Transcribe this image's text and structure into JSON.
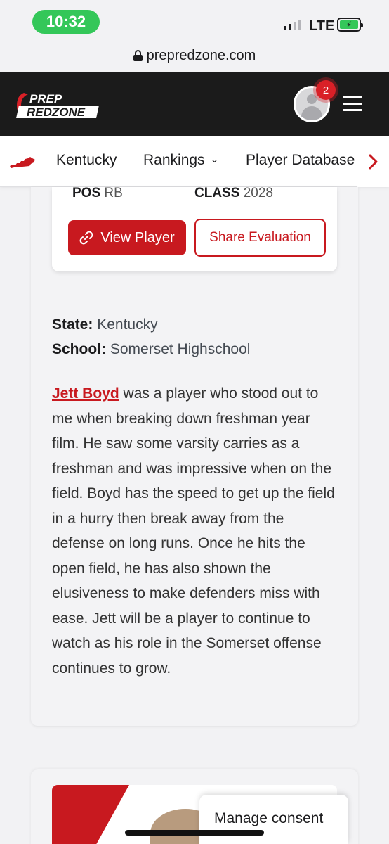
{
  "status_bar": {
    "time": "10:32",
    "carrier": "LTE",
    "battery_charging": true
  },
  "browser": {
    "url": "prepredzone.com"
  },
  "header": {
    "logo_line1": "PREP",
    "logo_line2": "REDZONE",
    "notification_count": "2",
    "accent_color": "#d92027"
  },
  "nav": {
    "items": [
      {
        "label": "Kentucky"
      },
      {
        "label": "Rankings"
      },
      {
        "label": "Player Database"
      }
    ]
  },
  "player_card": {
    "pos_label": "POS",
    "pos_value": "RB",
    "class_label": "CLASS",
    "class_value": "2028",
    "view_button": "View Player",
    "share_button": "Share Evaluation"
  },
  "info": {
    "state_label": "State:",
    "state_value": "Kentucky",
    "school_label": "School:",
    "school_value": "Somerset Highschool"
  },
  "evaluation": {
    "player_name": "Jett Boyd",
    "text": " was a player who stood out to me when breaking down freshman year film. He saw some varsity carries as a freshman and was impressive when on the field. Boyd has the speed to get up the field in a hurry then break away from the defense on long runs. Once he hits the open field, he has also shown the elusiveness to make defenders miss with ease. Jett will be a player to continue to watch as his role in the Somerset offense continues to grow."
  },
  "consent": {
    "label": "Manage consent"
  }
}
